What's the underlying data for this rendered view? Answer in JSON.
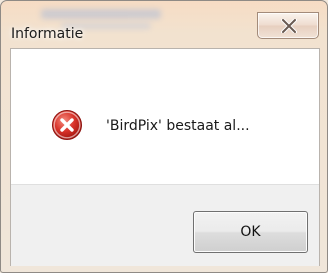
{
  "window": {
    "title": "Informatie",
    "close_icon": "close-x-icon"
  },
  "dialog": {
    "icon": "error-icon",
    "message": "'BirdPix' bestaat al..."
  },
  "buttons": {
    "ok_label": "OK"
  },
  "colors": {
    "error_red": "#d32f2f",
    "button_area": "#f0f0f0",
    "title_frame": "#f2e2cf"
  }
}
